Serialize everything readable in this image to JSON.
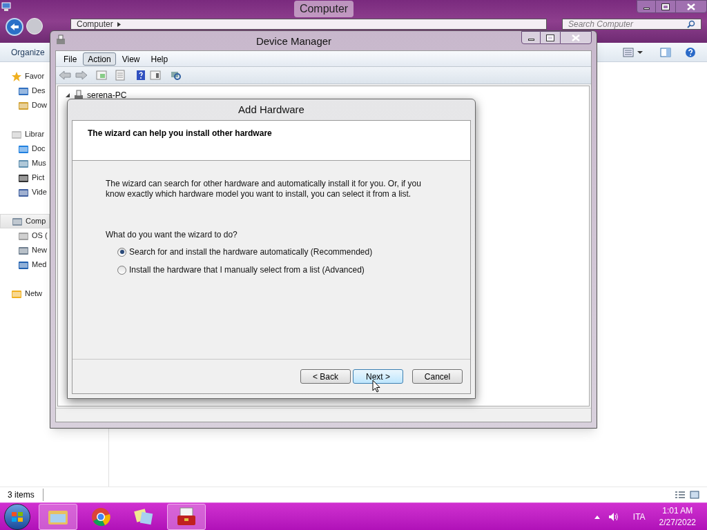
{
  "explorer": {
    "title": "Computer",
    "address": [
      "Computer"
    ],
    "search": {
      "placeholder": "Search Computer"
    },
    "toolbar": [
      "Organize"
    ],
    "sidebar": [
      {
        "label": "Favor",
        "selected": false,
        "items": [
          {
            "label": "Des",
            "selected": false
          },
          {
            "label": "Dow",
            "selected": false
          }
        ]
      },
      {
        "label": "Librar",
        "selected": false,
        "items": [
          {
            "label": "Doc",
            "selected": false
          },
          {
            "label": "Mus",
            "selected": false
          },
          {
            "label": "Pict",
            "selected": false
          },
          {
            "label": "Vide",
            "selected": false
          }
        ]
      },
      {
        "label": "Comp",
        "selected": true,
        "items": [
          {
            "label": "OS (",
            "selected": false
          },
          {
            "label": "New",
            "selected": false
          },
          {
            "label": "Med",
            "selected": false
          }
        ]
      },
      {
        "label": "Netw",
        "selected": false
      }
    ],
    "status": "3 items"
  },
  "device_manager": {
    "title": "Device Manager",
    "menu": [
      {
        "label": "File",
        "selected": false
      },
      {
        "label": "Action",
        "selected": true
      },
      {
        "label": "View",
        "selected": false
      },
      {
        "label": "Help",
        "selected": false
      }
    ],
    "tree": [
      {
        "label": "serena-PC",
        "expanded": true
      }
    ]
  },
  "dialog": {
    "title": "Add Hardware",
    "heading": "The wizard can help you install other hardware",
    "intro": "The wizard can search for other hardware and automatically install it for you. Or, if you know exactly which hardware model you want to install, you can select it from a list.",
    "question": "What do you want the wizard to do?",
    "options": [
      {
        "label": "Search for and install the hardware automatically (Recommended)",
        "selected": true
      },
      {
        "label": "Install the hardware that I manually select from a list (Advanced)",
        "selected": false
      }
    ],
    "buttons": [
      {
        "label": "< Back",
        "hovered": false
      },
      {
        "label": "Next >",
        "hovered": true
      },
      {
        "label": "Cancel",
        "hovered": false
      }
    ]
  },
  "taskbar": {
    "apps": [
      {
        "active": true
      },
      {
        "active": false
      },
      {
        "active": false
      },
      {
        "active": true
      }
    ],
    "tray": {
      "language": "ITA",
      "time": "1:01 AM",
      "date": "2/27/2022"
    }
  }
}
